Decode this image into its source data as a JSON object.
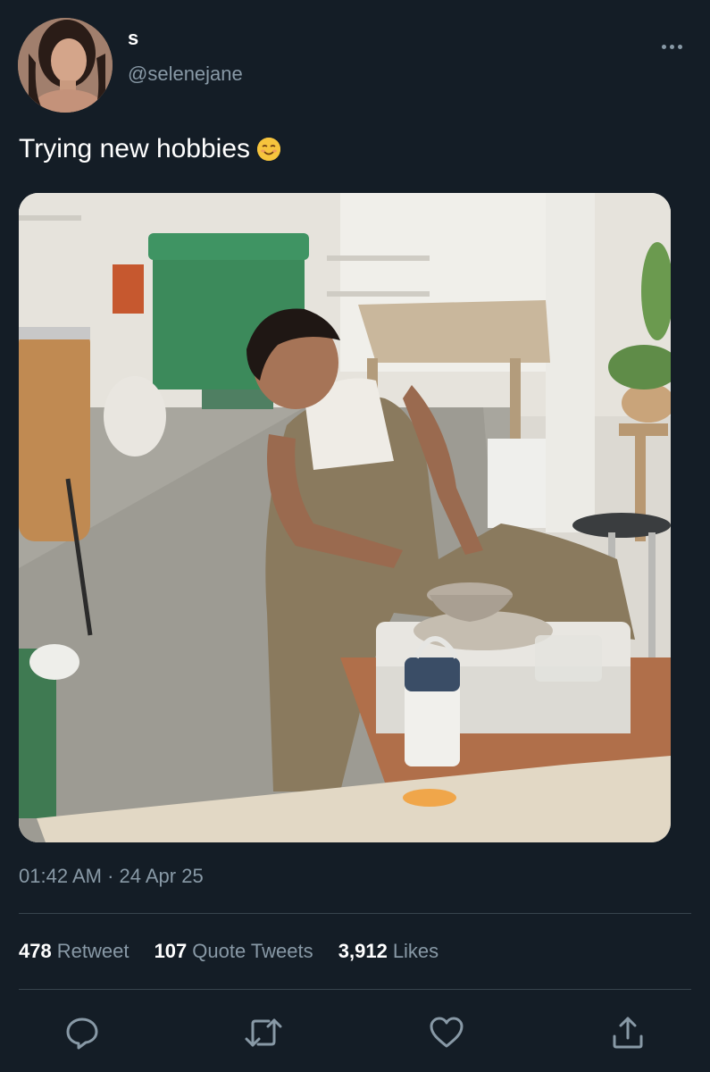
{
  "tweet": {
    "display_name": "s",
    "handle": "@selenejane",
    "text": "Trying new hobbies",
    "emoji_icon": "smiling-face-icon",
    "timestamp": "01:42 AM · 24 Apr 25"
  },
  "stats": {
    "retweets": "478",
    "retweets_label": "Retweet",
    "quotes": "107",
    "quotes_label": "Quote Tweets",
    "likes": "3,912",
    "likes_label": "Likes"
  },
  "actions": [
    "reply-icon",
    "retweet-icon",
    "like-icon",
    "share-icon"
  ],
  "colors": {
    "background": "#141d26",
    "secondary_text": "#8899a6",
    "divider": "#38444d",
    "icon": "#8899a6"
  }
}
